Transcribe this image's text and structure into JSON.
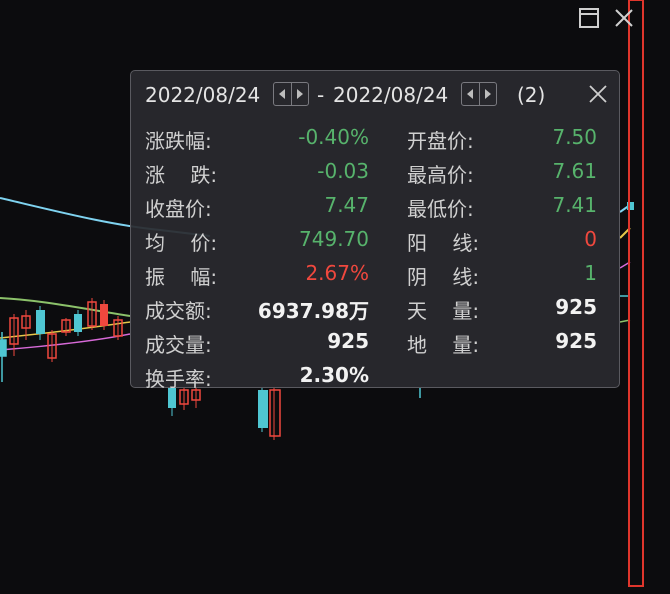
{
  "colors": {
    "background": "#0c0c0e",
    "up": "#f0483e",
    "down": "#57b36c",
    "neutral": "#f2f2f2",
    "candle_down": "#4fc6d2"
  },
  "window_controls": {
    "maximize": "maximize-icon",
    "close": "close-icon"
  },
  "popup": {
    "start_date": "2022/08/24",
    "end_date": "2022/08/24",
    "separator": "-",
    "count": "(2)",
    "rows": [
      {
        "l1": "涨跌幅:",
        "v1": "-0.40%",
        "l2": "开盘价:",
        "v2": "7.50"
      },
      {
        "l1": "涨    跌:",
        "v1": "-0.03",
        "l2": "最高价:",
        "v2": "7.61"
      },
      {
        "l1": "收盘价:",
        "v1": "7.47",
        "l2": "最低价:",
        "v2": "7.41"
      },
      {
        "l1": "均    价:",
        "v1": "749.70",
        "l2": "阳    线:",
        "v2": "0"
      },
      {
        "l1": "振    幅:",
        "v1": "2.67%",
        "l2": "阴    线:",
        "v2": "1"
      },
      {
        "l1": "成交额:",
        "v1": "6937.98万",
        "l2": "天    量:",
        "v2": "925"
      },
      {
        "l1": "成交量:",
        "v1": "925",
        "l2": "地    量:",
        "v2": "925"
      },
      {
        "l1": "换手率:",
        "v1": "2.30%",
        "l2": "",
        "v2": ""
      }
    ]
  }
}
